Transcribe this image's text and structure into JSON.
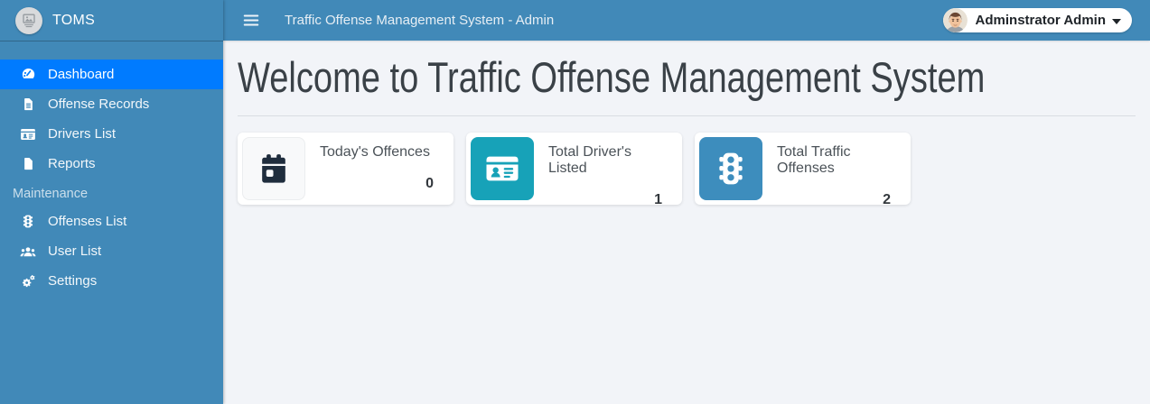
{
  "brand": {
    "name": "TOMS",
    "logo_icon": "image-placeholder-icon"
  },
  "topbar": {
    "title": "Traffic Offense Management System - Admin",
    "menu_icon": "hamburger-icon",
    "user": {
      "name": "Adminstrator Admin",
      "avatar_icon": "male-avatar",
      "caret_icon": "caret-down-icon"
    }
  },
  "sidebar": {
    "items": [
      {
        "label": "Dashboard",
        "icon": "gauge-icon",
        "active": true
      },
      {
        "label": "Offense Records",
        "icon": "file-lines-icon",
        "active": false
      },
      {
        "label": "Drivers List",
        "icon": "id-card-icon",
        "active": false
      },
      {
        "label": "Reports",
        "icon": "file-icon",
        "active": false
      }
    ],
    "section_header": "Maintenance",
    "maintenance_items": [
      {
        "label": "Offenses List",
        "icon": "traffic-light-icon"
      },
      {
        "label": "User List",
        "icon": "users-icon"
      },
      {
        "label": "Settings",
        "icon": "cogs-icon"
      }
    ]
  },
  "main": {
    "heading": "Welcome to Traffic Offense Management System",
    "cards": [
      {
        "label": "Today's Offences",
        "value": "0",
        "icon": "calendar-day-icon",
        "icon_bg": "#f8f9fa",
        "icon_color": "#1f2d3d"
      },
      {
        "label": "Total Driver's Listed",
        "value": "1",
        "icon": "id-card-icon",
        "icon_bg": "#17a2b8",
        "icon_color": "#ffffff"
      },
      {
        "label": "Total Traffic Offenses",
        "value": "2",
        "icon": "traffic-light-icon",
        "icon_bg": "#3d8dbd",
        "icon_color": "#ffffff"
      }
    ]
  },
  "colors": {
    "sidebar_bg": "#4189b8",
    "topbar_bg": "#4189b8",
    "active_item_bg": "#007bff",
    "content_bg": "#f2f4f8",
    "card_bg": "#ffffff",
    "teal_accent": "#17a2b8",
    "blue_accent": "#3d8dbd"
  }
}
